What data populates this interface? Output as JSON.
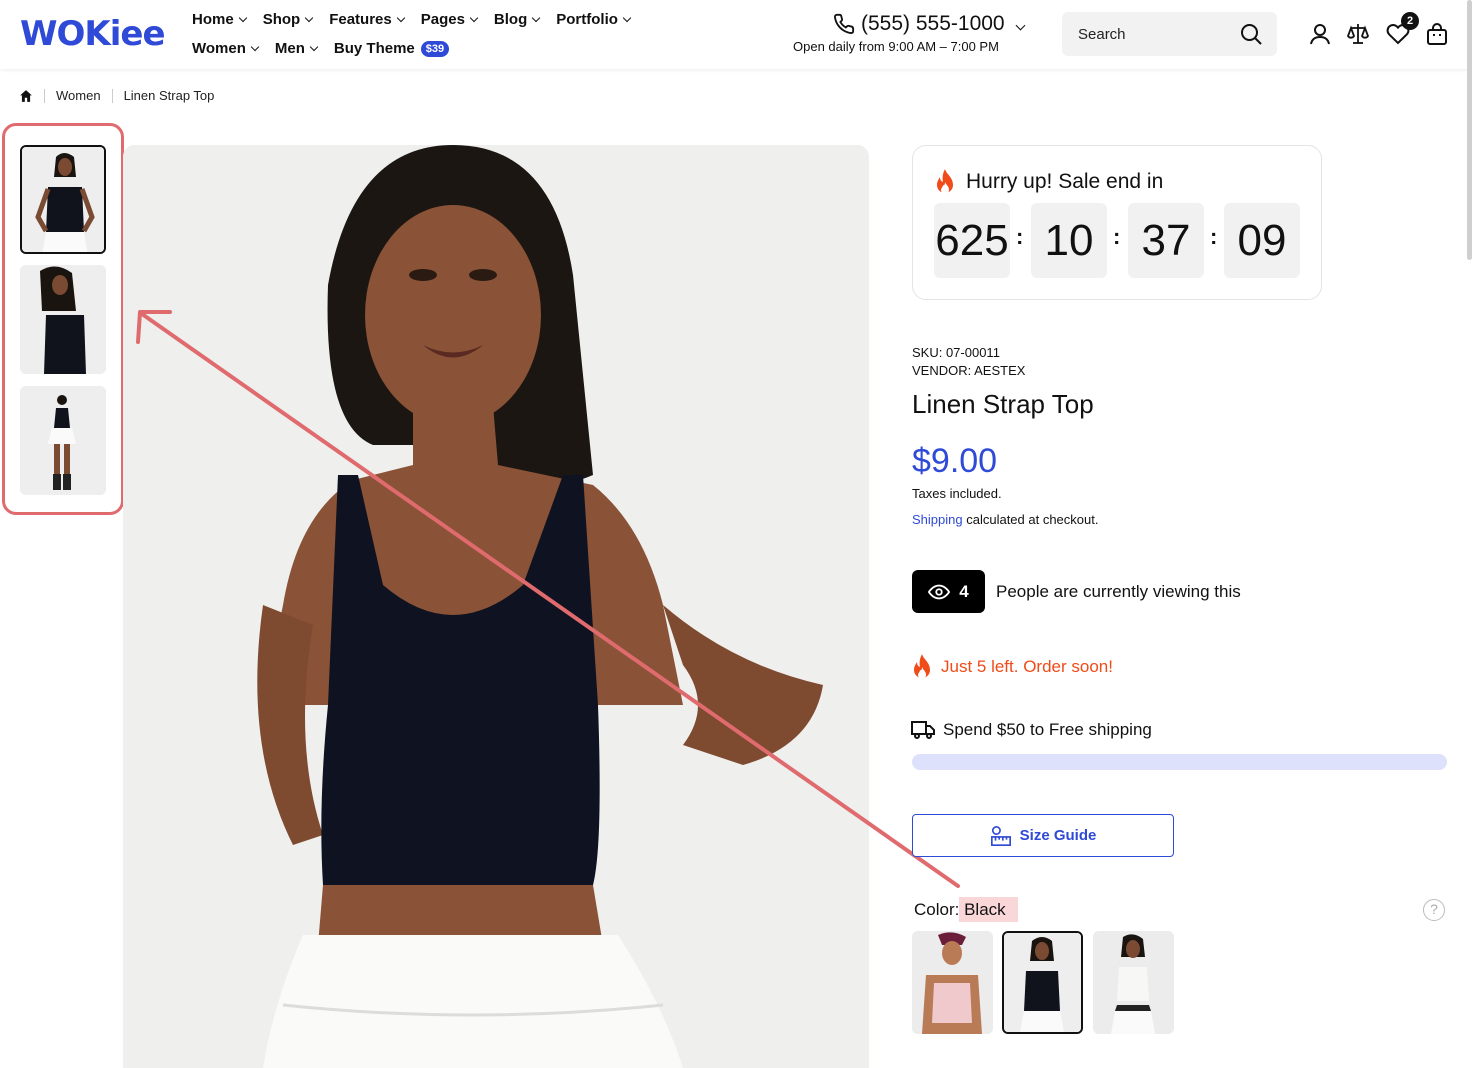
{
  "brand": {
    "logo_text": "WOKiee",
    "accent": "#2f4ad6",
    "sale_orange": "#f04b19"
  },
  "nav": {
    "row1": [
      "Home",
      "Shop",
      "Features",
      "Pages",
      "Blog",
      "Portfolio"
    ],
    "row2": [
      "Women",
      "Men"
    ],
    "buy_theme": "Buy Theme",
    "buy_theme_badge": "$39"
  },
  "contact": {
    "phone": "(555) 555-1000",
    "hours": "Open daily from 9:00 AM – 7:00 PM"
  },
  "search": {
    "placeholder": "Search"
  },
  "header_icons": {
    "account": "user-icon",
    "compare": "scale-icon",
    "wishlist": "heart-icon",
    "cart": "bag-icon",
    "wishlist_count": "2"
  },
  "breadcrumb": {
    "home_icon": "home-icon",
    "items": [
      "Women",
      "Linen Strap Top"
    ]
  },
  "gallery": {
    "thumbnail_count": 3,
    "active_thumbnail": 1
  },
  "countdown": {
    "title": "Hurry up! Sale end in",
    "days": "625",
    "hours": "10",
    "minutes": "37",
    "seconds": "09"
  },
  "product": {
    "sku": "SKU: 07-00011",
    "vendor": "VENDOR: AESTEX",
    "title": "Linen Strap Top",
    "price": "$9.00",
    "tax_note": "Taxes included.",
    "shipping_link": "Shipping",
    "shipping_note": " calculated at checkout."
  },
  "viewers": {
    "count": "4",
    "text": "People are currently viewing this"
  },
  "stock": {
    "text": "Just 5 left. Order soon!"
  },
  "free_shipping": {
    "text": "Spend $50 to Free shipping",
    "progress": 0
  },
  "size_guide": {
    "label": "Size Guide"
  },
  "color": {
    "label": "Color:",
    "value": "Black",
    "options": [
      "Pink",
      "Black",
      "White"
    ],
    "selected": "Black"
  },
  "help_icon": "?"
}
